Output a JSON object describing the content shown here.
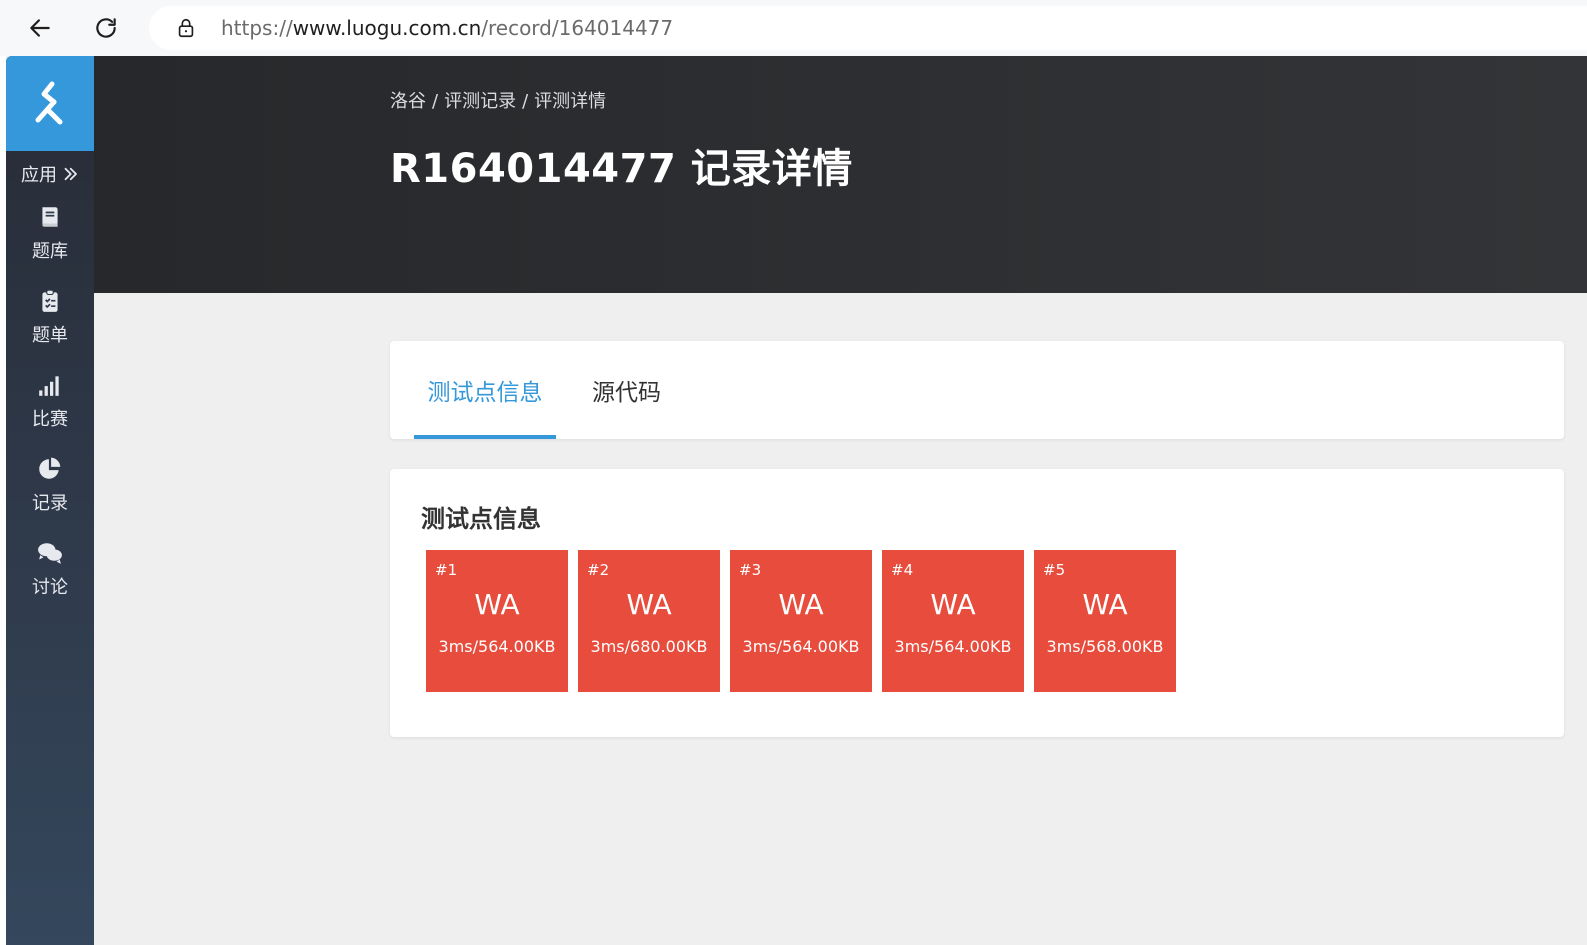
{
  "browser": {
    "url_scheme": "https://",
    "url_host": "www.luogu.com.cn",
    "url_path": "/record/164014477"
  },
  "sidebar": {
    "apps_label": "应用",
    "items": [
      {
        "label": "题库",
        "icon": "book-icon"
      },
      {
        "label": "题单",
        "icon": "clipboard-icon"
      },
      {
        "label": "比赛",
        "icon": "signal-bars-icon"
      },
      {
        "label": "记录",
        "icon": "pie-chart-icon"
      },
      {
        "label": "讨论",
        "icon": "chat-bubbles-icon"
      }
    ]
  },
  "header": {
    "breadcrumb": [
      "洛谷",
      "评测记录",
      "评测详情"
    ],
    "breadcrumb_sep": "/",
    "title": "R164014477 记录详情"
  },
  "tabs": [
    {
      "label": "测试点信息",
      "active": true
    },
    {
      "label": "源代码",
      "active": false
    }
  ],
  "testcases": {
    "title": "测试点信息",
    "items": [
      {
        "id": "#1",
        "status": "WA",
        "usage": "3ms/564.00KB"
      },
      {
        "id": "#2",
        "status": "WA",
        "usage": "3ms/680.00KB"
      },
      {
        "id": "#3",
        "status": "WA",
        "usage": "3ms/564.00KB"
      },
      {
        "id": "#4",
        "status": "WA",
        "usage": "3ms/564.00KB"
      },
      {
        "id": "#5",
        "status": "WA",
        "usage": "3ms/568.00KB"
      }
    ]
  },
  "colors": {
    "accent": "#3498db",
    "wa": "#e74c3c",
    "header_bg": "#2b2c2f",
    "sidebar_bg": "#2f3a4b"
  }
}
